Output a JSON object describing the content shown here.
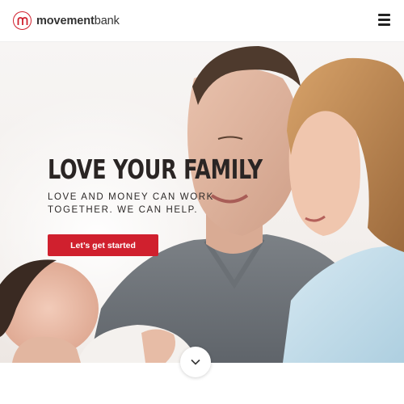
{
  "header": {
    "logo_bold": "movement",
    "logo_light": "bank",
    "menu_icon": "hamburger-menu-icon"
  },
  "hero": {
    "title": "LOVE YOUR FAMILY",
    "subtitle": "LOVE AND MONEY CAN WORK TOGETHER. WE CAN HELP.",
    "cta_label": "Let’s get started",
    "scroll_icon": "chevron-down-icon"
  },
  "colors": {
    "brand_red": "#d0202e",
    "text_dark": "#2a2524",
    "background": "#ffffff"
  }
}
